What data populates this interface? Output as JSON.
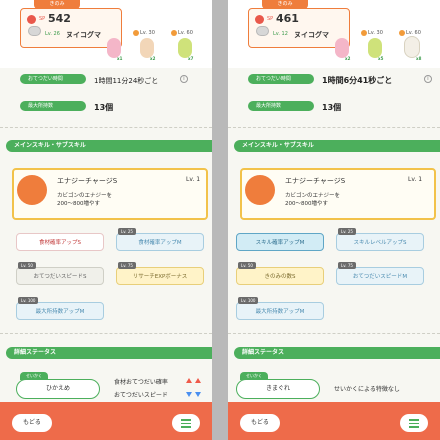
{
  "panels": [
    {
      "kiremi": "きのみ",
      "sp_label": "SP",
      "sp_value": "542",
      "mon_level": "Lv. 26",
      "mon_name": "ヌイコグマ",
      "foods": [
        {
          "lv": "",
          "count": "x1",
          "color": "#f4b6c8"
        },
        {
          "lv": "Lv. 30",
          "count": "x2",
          "color": "#f2d6b8"
        },
        {
          "lv": "Lv. 60",
          "count": "x7",
          "color": "#cfe27a"
        }
      ],
      "help_time_label": "おてつだい時間",
      "help_time": "1時間11分24秒ごと",
      "max_hold_label": "最大所持数",
      "max_hold": "13個",
      "section_skills": "メインスキル・サブスキル",
      "skill_name": "エナジーチャージS",
      "skill_lv": "Lv. 1",
      "skill_desc": [
        "カビゴンのエナジーを",
        "200〜800増やす"
      ],
      "subskills": [
        {
          "label": "食材確率アップS",
          "lvtag": "",
          "style": "white-red"
        },
        {
          "label": "食材確率アップM",
          "lvtag": "Lv. 25",
          "style": "blue"
        },
        {
          "label": "おてつだいスピードS",
          "lvtag": "Lv. 50",
          "style": "locked"
        },
        {
          "label": "リサーチEXPボーナス",
          "lvtag": "Lv. 75",
          "style": "gold"
        },
        {
          "label": "最大所持数アップM",
          "lvtag": "Lv. 100",
          "style": "blue"
        }
      ],
      "section_details": "詳細ステータス",
      "nature_tag": "せいかく",
      "nature": "ひかえめ",
      "nature_up": "食材おてつだい確率",
      "nature_down": "おてつだいスピード",
      "nature_none": "",
      "back": "もどる"
    },
    {
      "kiremi": "きのみ",
      "sp_label": "SP",
      "sp_value": "461",
      "mon_level": "Lv. 12",
      "mon_name": "ヌイコグマ",
      "foods": [
        {
          "lv": "",
          "count": "x2",
          "color": "#f4b6c8"
        },
        {
          "lv": "Lv. 30",
          "count": "x5",
          "color": "#cfe27a"
        },
        {
          "lv": "Lv. 60",
          "count": "x8",
          "color": "#f3efe6"
        }
      ],
      "help_time_label": "おてつだい時間",
      "help_time": "1時間6分41秒ごと",
      "max_hold_label": "最大所持数",
      "max_hold": "13個",
      "section_skills": "メインスキル・サブスキル",
      "skill_name": "エナジーチャージS",
      "skill_lv": "Lv. 1",
      "skill_desc": [
        "カビゴンのエナジーを",
        "200〜800増やす"
      ],
      "subskills": [
        {
          "label": "スキル確率アップM",
          "lvtag": "",
          "style": "sel-blue"
        },
        {
          "label": "スキルレベルアップS",
          "lvtag": "Lv. 25",
          "style": "blue"
        },
        {
          "label": "きのみの数S",
          "lvtag": "Lv. 50",
          "style": "gold"
        },
        {
          "label": "おてつだいスピードM",
          "lvtag": "Lv. 75",
          "style": "blue"
        },
        {
          "label": "最大所持数アップM",
          "lvtag": "Lv. 100",
          "style": "blue"
        }
      ],
      "section_details": "詳細ステータス",
      "nature_tag": "せいかく",
      "nature": "きまぐれ",
      "nature_up": "",
      "nature_down": "",
      "nature_none": "せいかくによる特徴なし",
      "back": "もどる"
    }
  ]
}
